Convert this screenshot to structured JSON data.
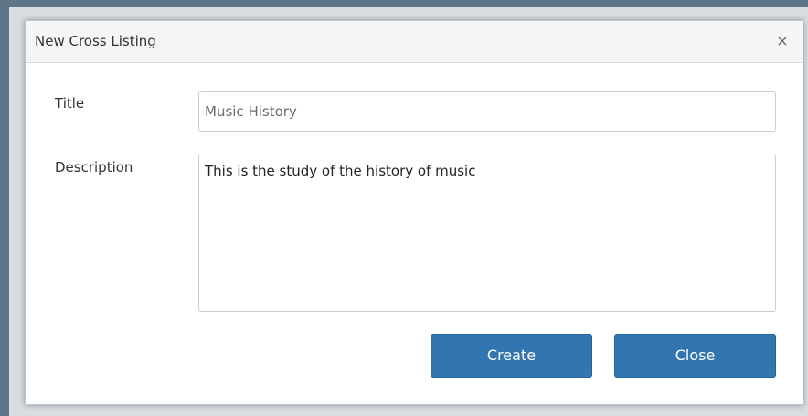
{
  "dialog": {
    "title": "New Cross Listing",
    "close_glyph": "×",
    "close_icon": "close-icon"
  },
  "form": {
    "title_label": "Title",
    "title_value": "Music History",
    "description_label": "Description",
    "description_value": "This is the study of the history of music"
  },
  "buttons": {
    "create_label": "Create",
    "close_label": "Close"
  },
  "colors": {
    "primary_button": "#3276b1",
    "backdrop": "#5e7688",
    "header_bg": "#f5f5f5"
  }
}
